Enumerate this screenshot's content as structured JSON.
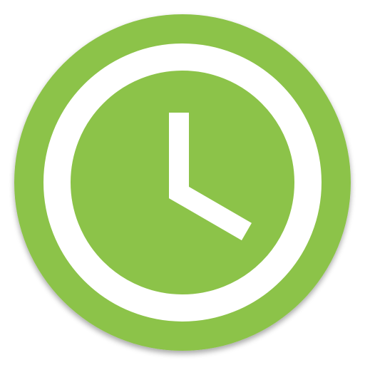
{
  "icon": {
    "name": "clock-icon",
    "colors": {
      "background": "#ffffff",
      "badge": "#8cc34a",
      "badge_shadow": "#6e9d38",
      "ring": "#ffffff",
      "hands": "#ffffff"
    }
  }
}
